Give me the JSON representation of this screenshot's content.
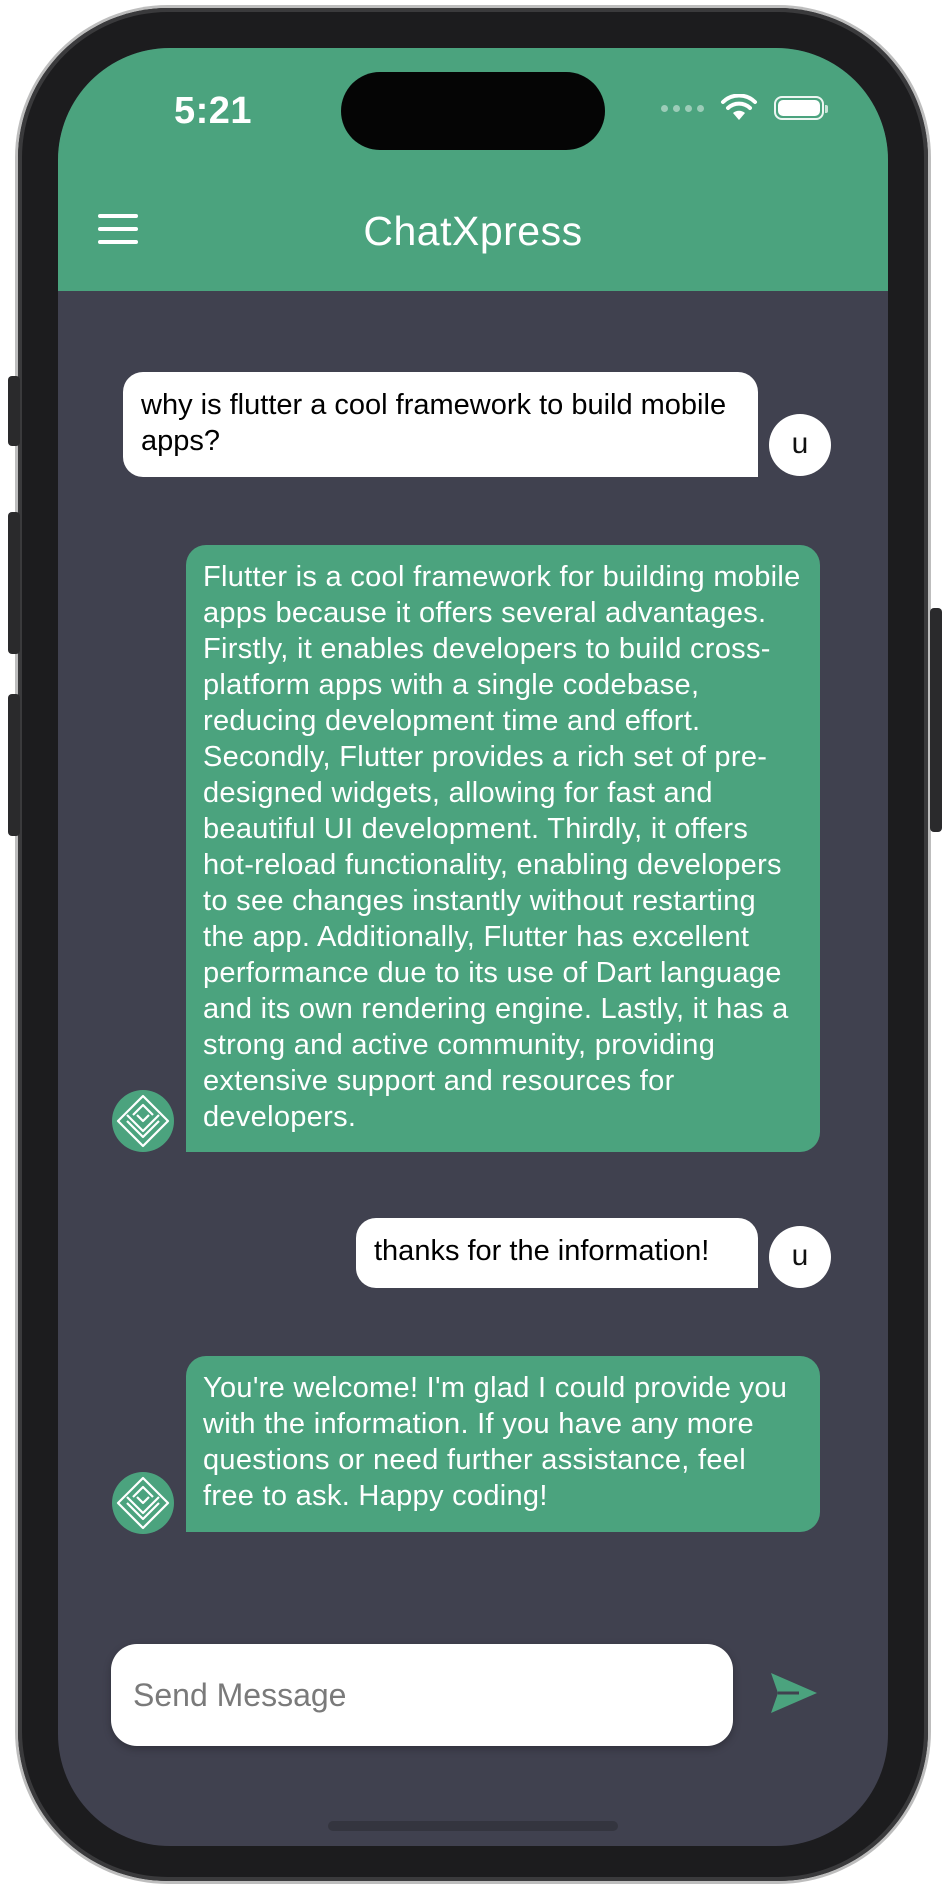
{
  "status_bar": {
    "time": "5:21"
  },
  "header": {
    "title": "ChatXpress"
  },
  "messages": [
    {
      "role": "user",
      "avatar": "u",
      "text": "why is flutter a cool framework to build mobile apps?"
    },
    {
      "role": "assistant",
      "avatar_icon": "diamond-logo-icon",
      "text": "Flutter is a cool framework for building mobile apps because it offers several advantages. Firstly, it enables developers to build cross-platform apps with a single codebase, reducing development time and effort. Secondly, Flutter provides a rich set of pre-designed widgets, allowing for fast and beautiful UI development. Thirdly, it offers hot-reload functionality, enabling developers to see changes instantly without restarting the app. Additionally, Flutter has excellent performance due to its use of Dart language and its own rendering engine. Lastly, it has a strong and active community, providing extensive support and resources for developers."
    },
    {
      "role": "user",
      "avatar": "u",
      "text": "thanks for the information!"
    },
    {
      "role": "assistant",
      "avatar_icon": "diamond-logo-icon",
      "text": "You're welcome! I'm glad I could provide you with the information. If you have any more questions or need further assistance, feel free to ask. Happy coding!"
    }
  ],
  "composer": {
    "placeholder": "Send Message",
    "value": ""
  },
  "colors": {
    "accent": "#4ba37e",
    "background": "#40414f",
    "user_bubble": "#ffffff"
  }
}
